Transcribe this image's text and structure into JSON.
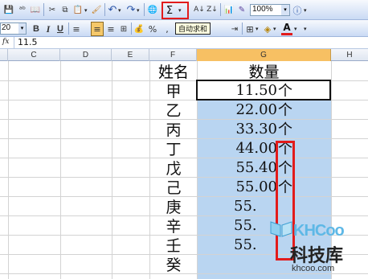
{
  "toolbar": {
    "zoom": "100%",
    "font_size": "20",
    "autosum_symbol": "Σ",
    "autosum_tooltip": "自动求和",
    "bold": "B",
    "italic": "I",
    "underline": "U",
    "percent": "%",
    "comma": ","
  },
  "formula_bar": {
    "fx": "fx",
    "value": "11.5"
  },
  "columns": [
    "C",
    "D",
    "E",
    "F",
    "G",
    "H"
  ],
  "sheet": {
    "header_name": "姓名",
    "header_qty": "数量",
    "rows": [
      {
        "name": "甲",
        "value": "11.50",
        "unit": "个"
      },
      {
        "name": "乙",
        "value": "22.00",
        "unit": "个"
      },
      {
        "name": "丙",
        "value": "33.30",
        "unit": "个"
      },
      {
        "name": "丁",
        "value": "44.00",
        "unit": "个"
      },
      {
        "name": "戊",
        "value": "55.40",
        "unit": "个"
      },
      {
        "name": "己",
        "value": "55.00",
        "unit": "个"
      },
      {
        "name": "庚",
        "value": "55.",
        "unit": ""
      },
      {
        "name": "辛",
        "value": "55.",
        "unit": ""
      },
      {
        "name": "壬",
        "value": "55.",
        "unit": ""
      },
      {
        "name": "癸",
        "value": "",
        "unit": ""
      }
    ]
  },
  "watermark": {
    "logo": "KHCoo",
    "name": "科技库",
    "url": "khcoo.com"
  },
  "colors": {
    "selection": "#b9d5f1",
    "highlight": "#e21b1b",
    "header_selected": "#f7c063"
  }
}
